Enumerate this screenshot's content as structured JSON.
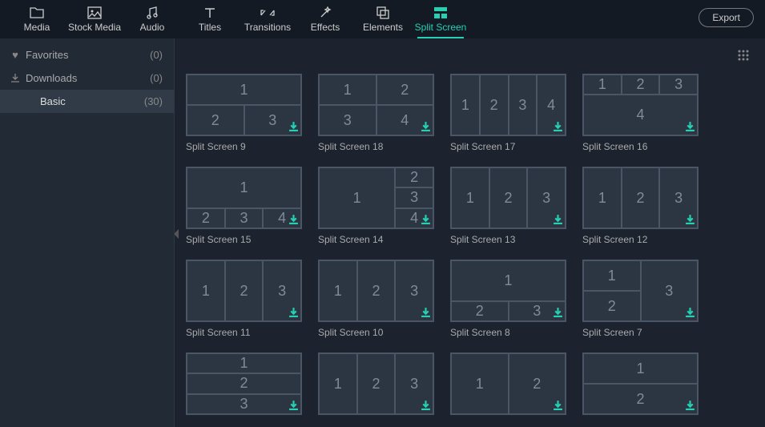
{
  "topbar": {
    "tabs": [
      {
        "label": "Media"
      },
      {
        "label": "Stock Media"
      },
      {
        "label": "Audio"
      },
      {
        "label": "Titles"
      },
      {
        "label": "Transitions"
      },
      {
        "label": "Effects"
      },
      {
        "label": "Elements"
      },
      {
        "label": "Split Screen",
        "active": true
      }
    ],
    "export_label": "Export"
  },
  "sidebar": {
    "items": [
      {
        "icon": "heart",
        "label": "Favorites",
        "count": "(0)"
      },
      {
        "icon": "download",
        "label": "Downloads",
        "count": "(0)"
      },
      {
        "icon": "",
        "label": "Basic",
        "count": "(30)",
        "selected": true
      }
    ]
  },
  "grid": {
    "items": [
      {
        "label": "Split Screen 9",
        "layout": "g9",
        "cells": [
          "1",
          "2",
          "3"
        ]
      },
      {
        "label": "Split Screen 18",
        "layout": "g18",
        "cells": [
          "1",
          "2",
          "3",
          "4"
        ]
      },
      {
        "label": "Split Screen 17",
        "layout": "g17",
        "cells": [
          "1",
          "2",
          "3",
          "4"
        ]
      },
      {
        "label": "Split Screen 16",
        "layout": "g16",
        "cells": [
          "1",
          "2",
          "3",
          "4"
        ]
      },
      {
        "label": "Split Screen 15",
        "layout": "g15",
        "cells": [
          "1",
          "2",
          "3",
          "4"
        ]
      },
      {
        "label": "Split Screen 14",
        "layout": "g14",
        "cells": [
          "1",
          "2",
          "3",
          "4"
        ]
      },
      {
        "label": "Split Screen 13",
        "layout": "g13",
        "cells": [
          "1",
          "2",
          "3"
        ]
      },
      {
        "label": "Split Screen 12",
        "layout": "g12",
        "cells": [
          "1",
          "2",
          "3"
        ]
      },
      {
        "label": "Split Screen 11",
        "layout": "g11",
        "cells": [
          "1",
          "2",
          "3"
        ]
      },
      {
        "label": "Split Screen 10",
        "layout": "g10",
        "cells": [
          "1",
          "2",
          "3"
        ]
      },
      {
        "label": "Split Screen 8",
        "layout": "g8",
        "cells": [
          "1",
          "2",
          "3"
        ]
      },
      {
        "label": "Split Screen 7",
        "layout": "g7",
        "cells": [
          "1",
          "2",
          "3"
        ]
      },
      {
        "label": "",
        "layout": "g6",
        "cells": [
          "1",
          "2",
          "3"
        ]
      },
      {
        "label": "",
        "layout": "g5",
        "cells": [
          "1",
          "2",
          "3"
        ]
      },
      {
        "label": "",
        "layout": "g4",
        "cells": [
          "1",
          "2"
        ]
      },
      {
        "label": "",
        "layout": "g3",
        "cells": [
          "1",
          "2"
        ]
      }
    ]
  }
}
